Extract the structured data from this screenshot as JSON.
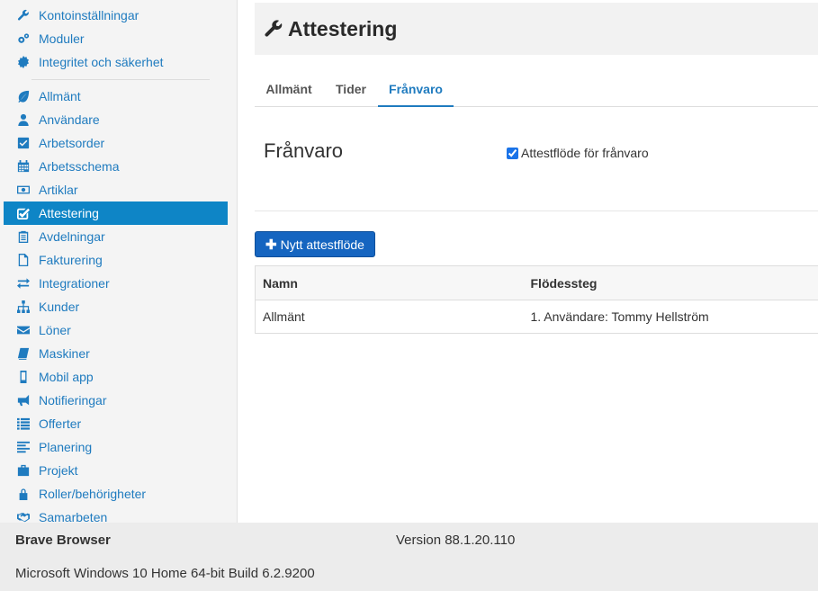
{
  "sidebar": {
    "settings": [
      {
        "label": "Kontoinställningar",
        "icon": "wrench-icon"
      },
      {
        "label": "Moduler",
        "icon": "cogs-icon"
      },
      {
        "label": "Integritet och säkerhet",
        "icon": "certificate-icon"
      }
    ],
    "modules": [
      {
        "label": "Allmänt",
        "icon": "leaf-icon"
      },
      {
        "label": "Användare",
        "icon": "user-icon"
      },
      {
        "label": "Arbetsorder",
        "icon": "check-square-icon"
      },
      {
        "label": "Arbetsschema",
        "icon": "calendar-icon"
      },
      {
        "label": "Artiklar",
        "icon": "money-icon"
      },
      {
        "label": "Attestering",
        "icon": "pencil-square-icon"
      },
      {
        "label": "Avdelningar",
        "icon": "clipboard-icon"
      },
      {
        "label": "Fakturering",
        "icon": "file-icon"
      },
      {
        "label": "Integrationer",
        "icon": "exchange-icon"
      },
      {
        "label": "Kunder",
        "icon": "sitemap-icon"
      },
      {
        "label": "Löner",
        "icon": "envelope-icon"
      },
      {
        "label": "Maskiner",
        "icon": "book-icon"
      },
      {
        "label": "Mobil app",
        "icon": "mobile-icon"
      },
      {
        "label": "Notifieringar",
        "icon": "bullhorn-icon"
      },
      {
        "label": "Offerter",
        "icon": "list-icon"
      },
      {
        "label": "Planering",
        "icon": "align-left-icon"
      },
      {
        "label": "Projekt",
        "icon": "briefcase-icon"
      },
      {
        "label": "Roller/behörigheter",
        "icon": "lock-icon"
      },
      {
        "label": "Samarbeten",
        "icon": "handshake-icon"
      }
    ],
    "active": "Attestering"
  },
  "header": {
    "title": "Attestering",
    "icon": "wrench-icon"
  },
  "tabs": [
    {
      "label": "Allmänt",
      "active": false
    },
    {
      "label": "Tider",
      "active": false
    },
    {
      "label": "Frånvaro",
      "active": true
    }
  ],
  "section": {
    "title": "Frånvaro",
    "checkbox_label": "Attestflöde för frånvaro",
    "checkbox_checked": true
  },
  "new_flow_button": {
    "label": "Nytt attestflöde",
    "icon": "plus-icon"
  },
  "table": {
    "columns": [
      "Namn",
      "Flödessteg"
    ],
    "rows": [
      [
        "Allmänt",
        "1. Användare: Tommy Hellström"
      ]
    ]
  },
  "footer": {
    "browser": "Brave Browser",
    "version": "Version 88.1.20.110",
    "os": "Microsoft Windows 10 Home 64-bit Build 6.2.9200"
  },
  "colors": {
    "accent": "#1f7bbf",
    "active_nav": "#0e85c6",
    "button": "#1565c0"
  }
}
